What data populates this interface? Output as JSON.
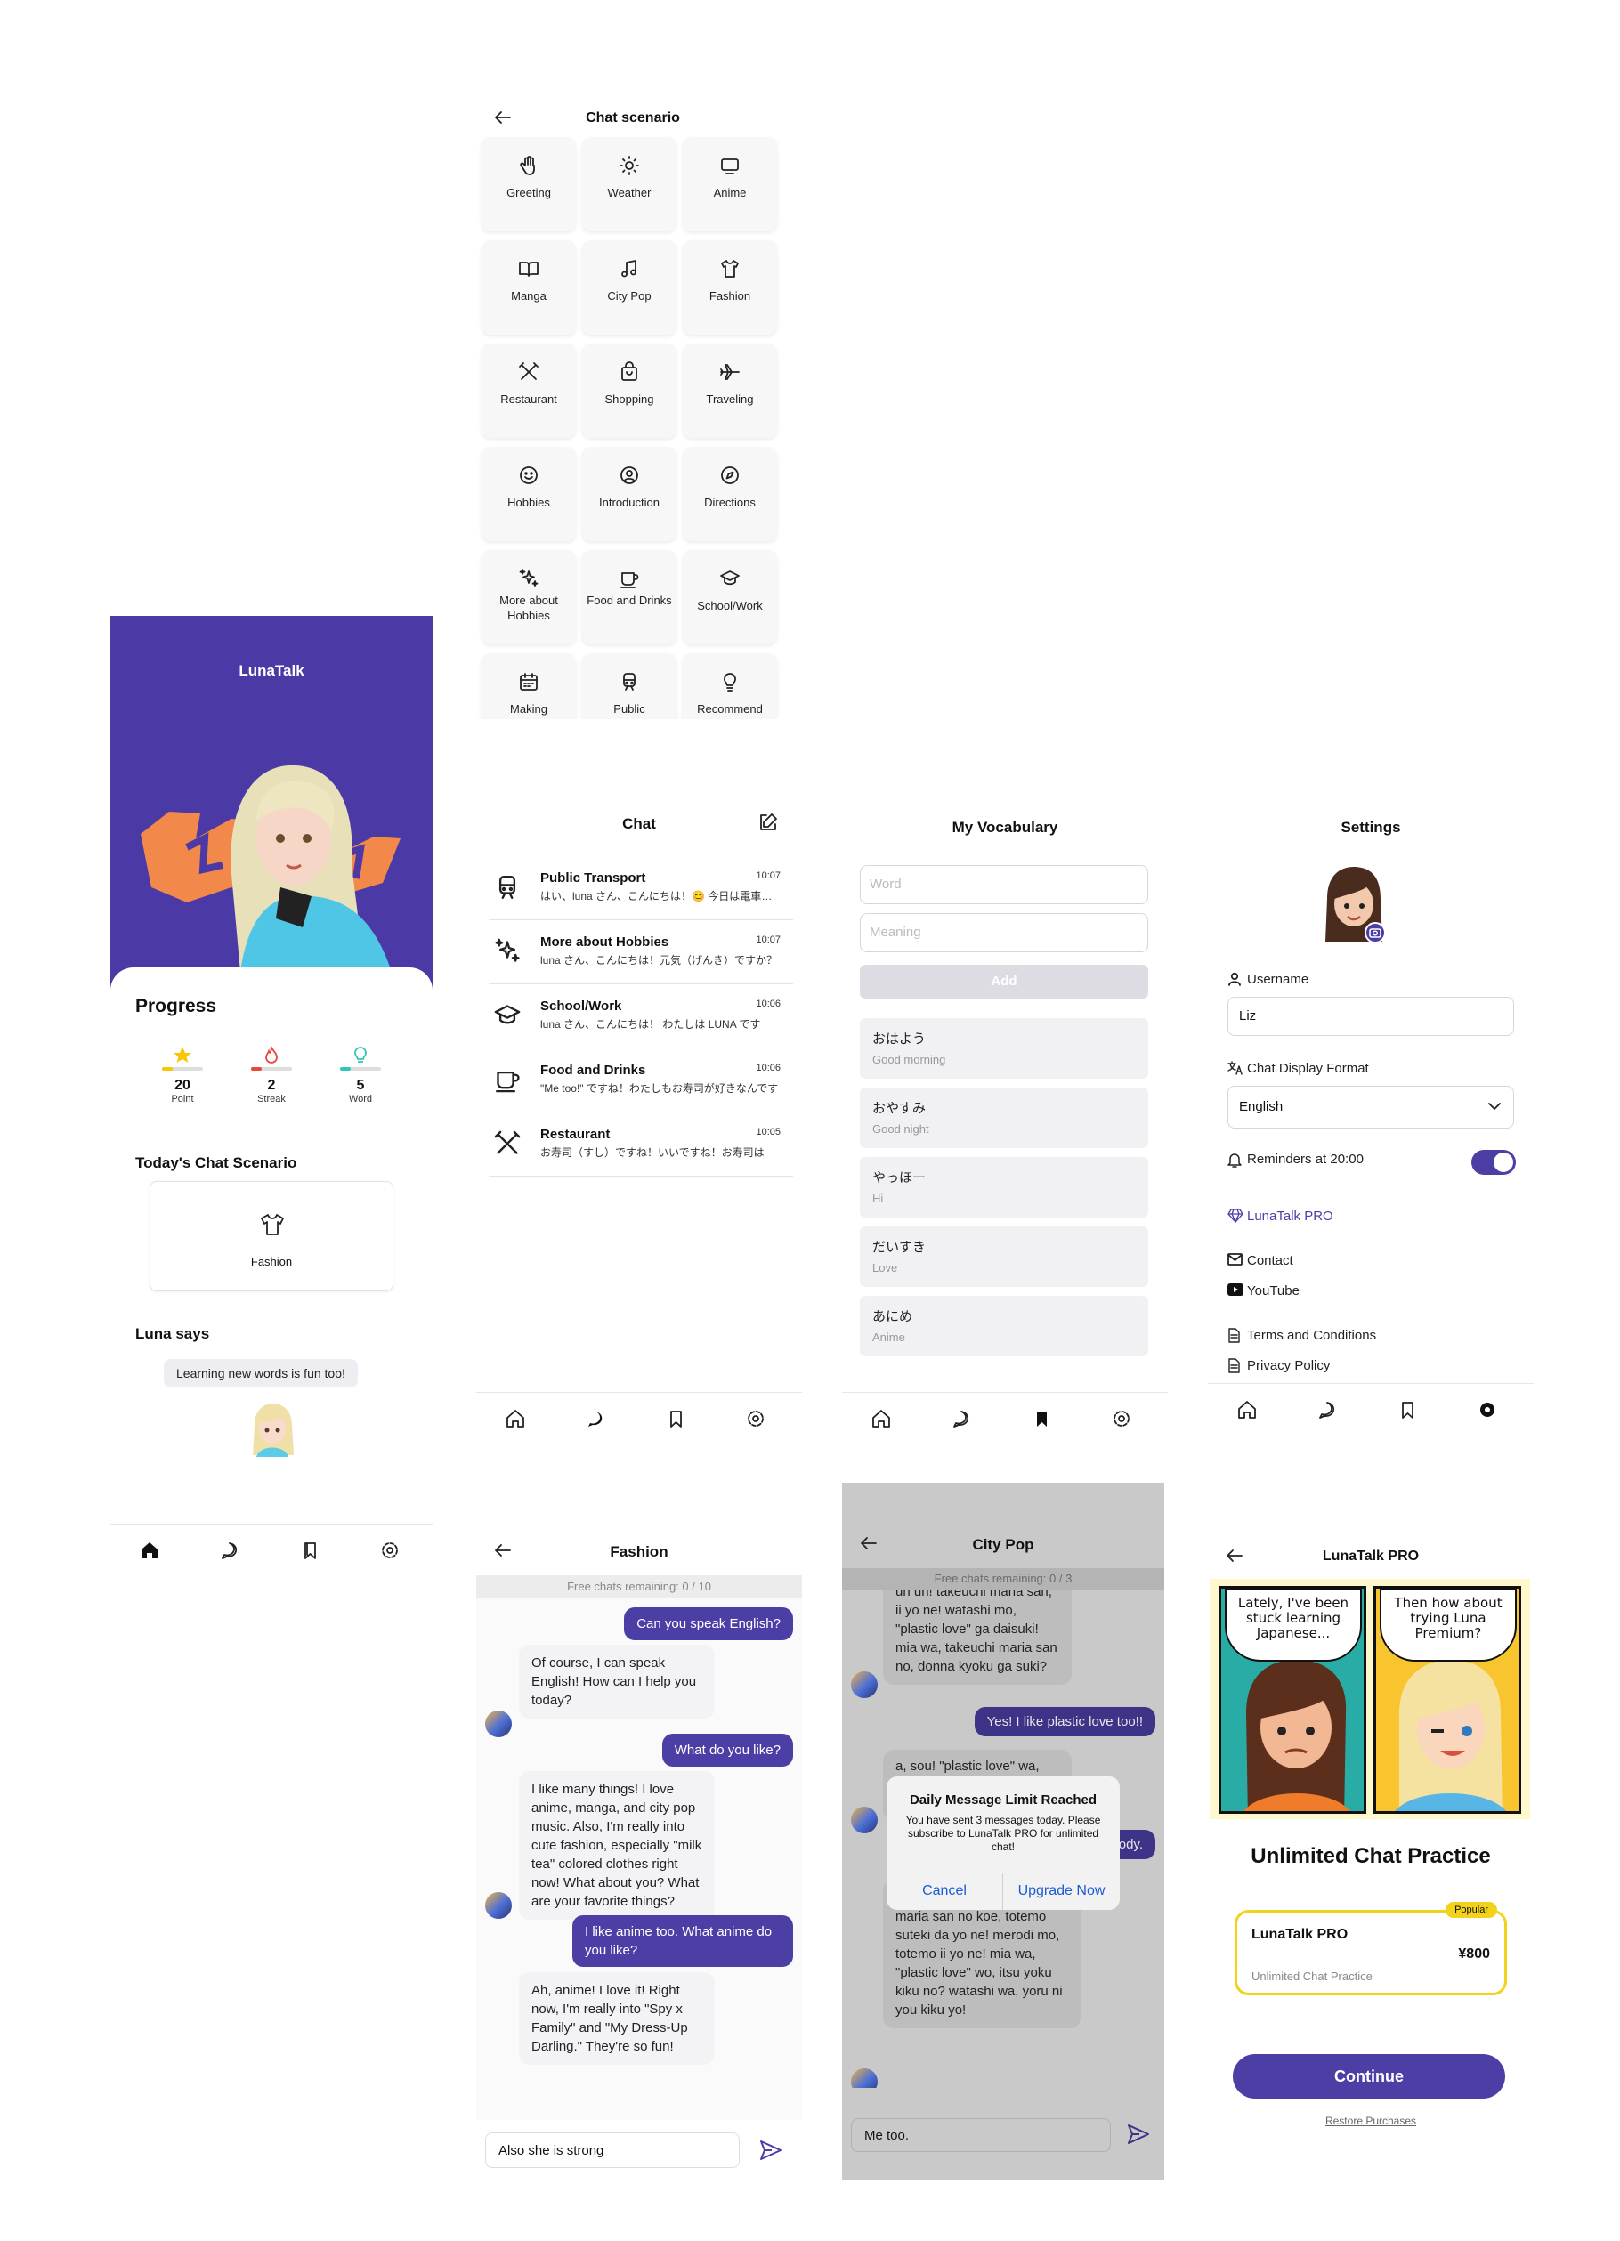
{
  "home": {
    "app_title": "LunaTalk",
    "progress_title": "Progress",
    "stats": [
      {
        "value": "20",
        "label": "Point",
        "color": "#f7c800"
      },
      {
        "value": "2",
        "label": "Streak",
        "color": "#e8483d"
      },
      {
        "value": "5",
        "label": "Word",
        "color": "#2fc7b5"
      }
    ],
    "scenario_title": "Today's Chat Scenario",
    "scenario_name": "Fashion",
    "luna_title": "Luna says",
    "luna_quote": "Learning new words is fun too!"
  },
  "scenario_grid": {
    "title": "Chat scenario",
    "tiles": [
      {
        "label": "Greeting",
        "icon": "hand-icon"
      },
      {
        "label": "Weather",
        "icon": "sun-icon"
      },
      {
        "label": "Anime",
        "icon": "tv-icon"
      },
      {
        "label": "Manga",
        "icon": "book-icon"
      },
      {
        "label": "City Pop",
        "icon": "music-icon"
      },
      {
        "label": "Fashion",
        "icon": "shirt-icon"
      },
      {
        "label": "Restaurant",
        "icon": "utensils-icon"
      },
      {
        "label": "Shopping",
        "icon": "bag-icon"
      },
      {
        "label": "Traveling",
        "icon": "plane-icon"
      },
      {
        "label": "Hobbies",
        "icon": "smile-icon"
      },
      {
        "label": "Introduction",
        "icon": "user-circle-icon"
      },
      {
        "label": "Directions",
        "icon": "compass-icon"
      },
      {
        "label": "More about Hobbies",
        "icon": "sparkles-icon"
      },
      {
        "label": "Food and Drinks",
        "icon": "cup-icon"
      },
      {
        "label": "School/Work",
        "icon": "graduation-cap-icon"
      },
      {
        "label": "Making",
        "icon": "calendar-icon"
      },
      {
        "label": "Public",
        "icon": "train-icon"
      },
      {
        "label": "Recommend",
        "icon": "lightbulb-icon"
      }
    ]
  },
  "chat_list": {
    "title": "Chat",
    "items": [
      {
        "name": "Public Transport",
        "time": "10:07",
        "preview": "はい、luna さん、こんにちは！😊 今日は電車について"
      },
      {
        "name": "More about Hobbies",
        "time": "10:07",
        "preview": "luna さん、こんにちは！元気（げんき）ですか？"
      },
      {
        "name": "School/Work",
        "time": "10:06",
        "preview": "luna さん、こんにちは！ わたしは LUNA です"
      },
      {
        "name": "Food and Drinks",
        "time": "10:06",
        "preview": "\"Me too!\" ですね！わたしもお寿司が好きなんです"
      },
      {
        "name": "Restaurant",
        "time": "10:05",
        "preview": "お寿司（すし）ですね！いいですね！お寿司は"
      }
    ]
  },
  "vocabulary": {
    "title": "My Vocabulary",
    "word_placeholder": "Word",
    "meaning_placeholder": "Meaning",
    "add_label": "Add",
    "entries": [
      {
        "word": "おはよう",
        "meaning": "Good morning"
      },
      {
        "word": "おやすみ",
        "meaning": "Good night"
      },
      {
        "word": "やっほー",
        "meaning": "Hi"
      },
      {
        "word": "だいすき",
        "meaning": "Love"
      },
      {
        "word": "あにめ",
        "meaning": "Anime"
      }
    ]
  },
  "settings": {
    "title": "Settings",
    "username_label": "Username",
    "username_value": "Liz",
    "display_format_label": "Chat Display Format",
    "display_format_value": "English",
    "reminders_label": "Reminders at 20:00",
    "reminders_on": true,
    "pro_label": "LunaTalk PRO",
    "contact_label": "Contact",
    "youtube_label": "YouTube",
    "terms_label": "Terms and Conditions",
    "privacy_label": "Privacy Policy"
  },
  "fashion_chat": {
    "title": "Fashion",
    "remaining": "Free chats remaining: 0 / 10",
    "messages": [
      {
        "from": "user",
        "text": "Can you speak English?"
      },
      {
        "from": "bot",
        "text": "Of course, I can speak English! How can I help you today?"
      },
      {
        "from": "user",
        "text": "What do you like?"
      },
      {
        "from": "bot",
        "text": "I like many things! I love anime, manga, and city pop music. Also, I'm really into cute fashion, especially \"milk tea\" colored clothes right now! What about you? What are your favorite things?"
      },
      {
        "from": "user",
        "text": "I like anime too. What anime do you like?"
      },
      {
        "from": "bot",
        "text": "Ah, anime! I love it! Right now, I'm really into \"Spy x Family\" and \"My Dress-Up Darling.\" They're so fun!"
      }
    ],
    "input_value": "Also she is strong"
  },
  "citypop_chat": {
    "title": "City Pop",
    "remaining": "Free chats remaining: 0 / 3",
    "msg_top": "un un! takeuchi maria san, ii yo ne! watashi mo, \"plastic love\" ga daisuki! mia wa, takeuchi maria san no, donna kyoku ga suki?",
    "msg_user": "Yes! I like plastic love too!!",
    "msg_mid": "a, sou! \"plastic love\" wa,",
    "msg_user2": "I like her voice and melody.",
    "msg_bottom": "un un! wakaru! takeuchi maria san no koe, totemo suteki da yo ne! merodi mo, totemo ii yo ne! mia wa, \"plastic love\" wo, itsu yoku kiku no? watashi wa, yoru ni you kiku yo!",
    "input_value": "Me too.",
    "dialog": {
      "title": "Daily Message Limit Reached",
      "body": "You have sent 3 messages today. Please subscribe to LunaTalk PRO for unlimited chat!",
      "cancel": "Cancel",
      "upgrade": "Upgrade Now"
    }
  },
  "pro": {
    "title": "LunaTalk PRO",
    "comic_left": "Lately, I've been stuck learning Japanese...",
    "comic_right": "Then how about trying Luna Premium?",
    "headline": "Unlimited Chat Practice",
    "badge": "Popular",
    "plan_name": "LunaTalk PRO",
    "plan_price": "¥800",
    "plan_desc": "Unlimited Chat Practice",
    "continue_label": "Continue",
    "restore_label": "Restore Purchases"
  },
  "colors": {
    "accent": "#4b3fa6",
    "hero": "#4b39a6",
    "pro_border": "#f2d21a"
  }
}
